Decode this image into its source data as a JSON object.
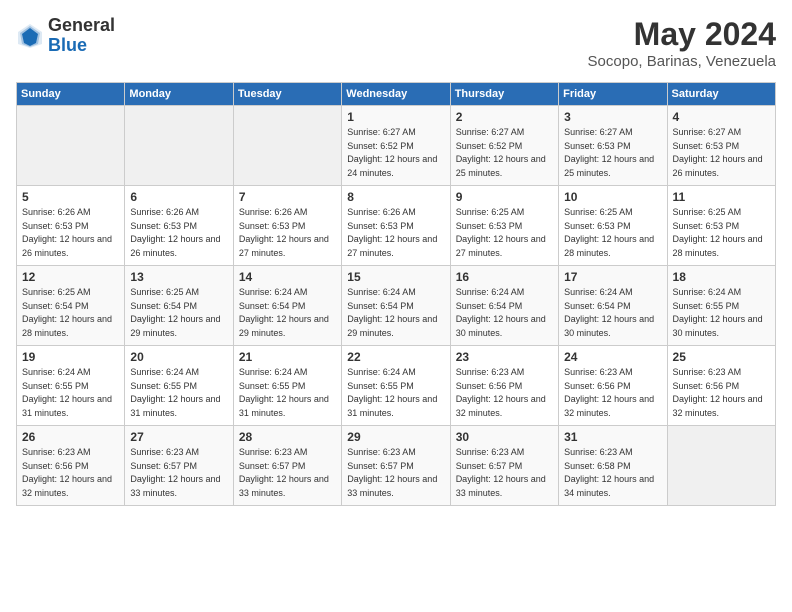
{
  "header": {
    "logo_general": "General",
    "logo_blue": "Blue",
    "month_title": "May 2024",
    "location": "Socopo, Barinas, Venezuela"
  },
  "days_of_week": [
    "Sunday",
    "Monday",
    "Tuesday",
    "Wednesday",
    "Thursday",
    "Friday",
    "Saturday"
  ],
  "weeks": [
    [
      {
        "day": "",
        "sunrise": "",
        "sunset": "",
        "daylight": ""
      },
      {
        "day": "",
        "sunrise": "",
        "sunset": "",
        "daylight": ""
      },
      {
        "day": "",
        "sunrise": "",
        "sunset": "",
        "daylight": ""
      },
      {
        "day": "1",
        "sunrise": "Sunrise: 6:27 AM",
        "sunset": "Sunset: 6:52 PM",
        "daylight": "Daylight: 12 hours and 24 minutes."
      },
      {
        "day": "2",
        "sunrise": "Sunrise: 6:27 AM",
        "sunset": "Sunset: 6:52 PM",
        "daylight": "Daylight: 12 hours and 25 minutes."
      },
      {
        "day": "3",
        "sunrise": "Sunrise: 6:27 AM",
        "sunset": "Sunset: 6:53 PM",
        "daylight": "Daylight: 12 hours and 25 minutes."
      },
      {
        "day": "4",
        "sunrise": "Sunrise: 6:27 AM",
        "sunset": "Sunset: 6:53 PM",
        "daylight": "Daylight: 12 hours and 26 minutes."
      }
    ],
    [
      {
        "day": "5",
        "sunrise": "Sunrise: 6:26 AM",
        "sunset": "Sunset: 6:53 PM",
        "daylight": "Daylight: 12 hours and 26 minutes."
      },
      {
        "day": "6",
        "sunrise": "Sunrise: 6:26 AM",
        "sunset": "Sunset: 6:53 PM",
        "daylight": "Daylight: 12 hours and 26 minutes."
      },
      {
        "day": "7",
        "sunrise": "Sunrise: 6:26 AM",
        "sunset": "Sunset: 6:53 PM",
        "daylight": "Daylight: 12 hours and 27 minutes."
      },
      {
        "day": "8",
        "sunrise": "Sunrise: 6:26 AM",
        "sunset": "Sunset: 6:53 PM",
        "daylight": "Daylight: 12 hours and 27 minutes."
      },
      {
        "day": "9",
        "sunrise": "Sunrise: 6:25 AM",
        "sunset": "Sunset: 6:53 PM",
        "daylight": "Daylight: 12 hours and 27 minutes."
      },
      {
        "day": "10",
        "sunrise": "Sunrise: 6:25 AM",
        "sunset": "Sunset: 6:53 PM",
        "daylight": "Daylight: 12 hours and 28 minutes."
      },
      {
        "day": "11",
        "sunrise": "Sunrise: 6:25 AM",
        "sunset": "Sunset: 6:53 PM",
        "daylight": "Daylight: 12 hours and 28 minutes."
      }
    ],
    [
      {
        "day": "12",
        "sunrise": "Sunrise: 6:25 AM",
        "sunset": "Sunset: 6:54 PM",
        "daylight": "Daylight: 12 hours and 28 minutes."
      },
      {
        "day": "13",
        "sunrise": "Sunrise: 6:25 AM",
        "sunset": "Sunset: 6:54 PM",
        "daylight": "Daylight: 12 hours and 29 minutes."
      },
      {
        "day": "14",
        "sunrise": "Sunrise: 6:24 AM",
        "sunset": "Sunset: 6:54 PM",
        "daylight": "Daylight: 12 hours and 29 minutes."
      },
      {
        "day": "15",
        "sunrise": "Sunrise: 6:24 AM",
        "sunset": "Sunset: 6:54 PM",
        "daylight": "Daylight: 12 hours and 29 minutes."
      },
      {
        "day": "16",
        "sunrise": "Sunrise: 6:24 AM",
        "sunset": "Sunset: 6:54 PM",
        "daylight": "Daylight: 12 hours and 30 minutes."
      },
      {
        "day": "17",
        "sunrise": "Sunrise: 6:24 AM",
        "sunset": "Sunset: 6:54 PM",
        "daylight": "Daylight: 12 hours and 30 minutes."
      },
      {
        "day": "18",
        "sunrise": "Sunrise: 6:24 AM",
        "sunset": "Sunset: 6:55 PM",
        "daylight": "Daylight: 12 hours and 30 minutes."
      }
    ],
    [
      {
        "day": "19",
        "sunrise": "Sunrise: 6:24 AM",
        "sunset": "Sunset: 6:55 PM",
        "daylight": "Daylight: 12 hours and 31 minutes."
      },
      {
        "day": "20",
        "sunrise": "Sunrise: 6:24 AM",
        "sunset": "Sunset: 6:55 PM",
        "daylight": "Daylight: 12 hours and 31 minutes."
      },
      {
        "day": "21",
        "sunrise": "Sunrise: 6:24 AM",
        "sunset": "Sunset: 6:55 PM",
        "daylight": "Daylight: 12 hours and 31 minutes."
      },
      {
        "day": "22",
        "sunrise": "Sunrise: 6:24 AM",
        "sunset": "Sunset: 6:55 PM",
        "daylight": "Daylight: 12 hours and 31 minutes."
      },
      {
        "day": "23",
        "sunrise": "Sunrise: 6:23 AM",
        "sunset": "Sunset: 6:56 PM",
        "daylight": "Daylight: 12 hours and 32 minutes."
      },
      {
        "day": "24",
        "sunrise": "Sunrise: 6:23 AM",
        "sunset": "Sunset: 6:56 PM",
        "daylight": "Daylight: 12 hours and 32 minutes."
      },
      {
        "day": "25",
        "sunrise": "Sunrise: 6:23 AM",
        "sunset": "Sunset: 6:56 PM",
        "daylight": "Daylight: 12 hours and 32 minutes."
      }
    ],
    [
      {
        "day": "26",
        "sunrise": "Sunrise: 6:23 AM",
        "sunset": "Sunset: 6:56 PM",
        "daylight": "Daylight: 12 hours and 32 minutes."
      },
      {
        "day": "27",
        "sunrise": "Sunrise: 6:23 AM",
        "sunset": "Sunset: 6:57 PM",
        "daylight": "Daylight: 12 hours and 33 minutes."
      },
      {
        "day": "28",
        "sunrise": "Sunrise: 6:23 AM",
        "sunset": "Sunset: 6:57 PM",
        "daylight": "Daylight: 12 hours and 33 minutes."
      },
      {
        "day": "29",
        "sunrise": "Sunrise: 6:23 AM",
        "sunset": "Sunset: 6:57 PM",
        "daylight": "Daylight: 12 hours and 33 minutes."
      },
      {
        "day": "30",
        "sunrise": "Sunrise: 6:23 AM",
        "sunset": "Sunset: 6:57 PM",
        "daylight": "Daylight: 12 hours and 33 minutes."
      },
      {
        "day": "31",
        "sunrise": "Sunrise: 6:23 AM",
        "sunset": "Sunset: 6:58 PM",
        "daylight": "Daylight: 12 hours and 34 minutes."
      },
      {
        "day": "",
        "sunrise": "",
        "sunset": "",
        "daylight": ""
      }
    ]
  ]
}
